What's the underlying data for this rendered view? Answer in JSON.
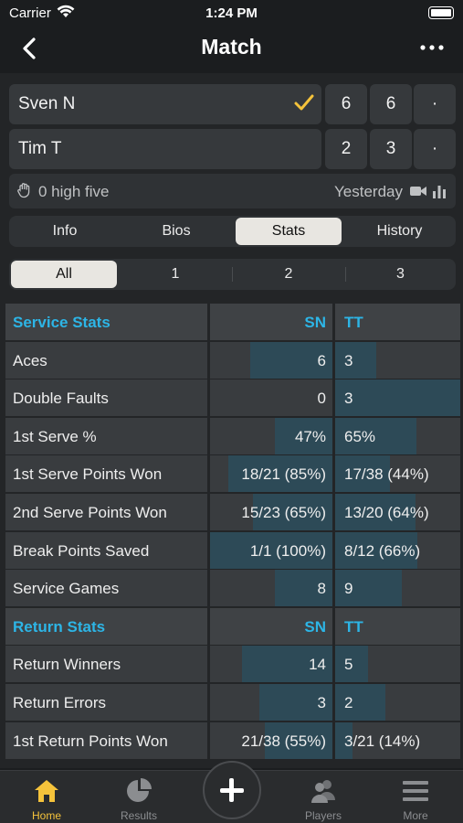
{
  "status": {
    "carrier": "Carrier",
    "time": "1:24 PM"
  },
  "nav": {
    "title": "Match"
  },
  "players": [
    {
      "name": "Sven N",
      "sets": [
        "6",
        "6",
        "·"
      ]
    },
    {
      "name": "Tim T",
      "sets": [
        "2",
        "3",
        "·"
      ]
    }
  ],
  "info": {
    "high_five": "0 high five",
    "date": "Yesterday"
  },
  "tabs": [
    {
      "label": "Info",
      "active": false
    },
    {
      "label": "Bios",
      "active": false
    },
    {
      "label": "Stats",
      "active": true
    },
    {
      "label": "History",
      "active": false
    }
  ],
  "set_filter": [
    {
      "label": "All",
      "active": true
    },
    {
      "label": "1",
      "active": false
    },
    {
      "label": "2",
      "active": false
    },
    {
      "label": "3",
      "active": false
    }
  ],
  "stats": [
    {
      "type": "header",
      "label": "Service Stats",
      "sn": "SN",
      "tt": "TT"
    },
    {
      "label": "Aces",
      "sn": "6",
      "tt": "3",
      "sn_share": 0.67,
      "tt_share": 0.33
    },
    {
      "label": "Double Faults",
      "sn": "0",
      "tt": "3",
      "sn_share": 0.0,
      "tt_share": 1.0
    },
    {
      "label": "1st Serve %",
      "sn": "47%",
      "tt": "65%",
      "sn_share": 0.47,
      "tt_share": 0.65
    },
    {
      "label": "1st Serve Points Won",
      "sn": "18/21 (85%)",
      "tt": "17/38 (44%)",
      "sn_share": 0.85,
      "tt_share": 0.44
    },
    {
      "label": "2nd Serve Points Won",
      "sn": "15/23 (65%)",
      "tt": "13/20 (64%)",
      "sn_share": 0.65,
      "tt_share": 0.64
    },
    {
      "label": "Break Points Saved",
      "sn": "1/1 (100%)",
      "tt": "8/12 (66%)",
      "sn_share": 1.0,
      "tt_share": 0.66
    },
    {
      "label": "Service Games",
      "sn": "8",
      "tt": "9",
      "sn_share": 0.47,
      "tt_share": 0.53
    },
    {
      "type": "header",
      "label": "Return Stats",
      "sn": "SN",
      "tt": "TT"
    },
    {
      "label": "Return Winners",
      "sn": "14",
      "tt": "5",
      "sn_share": 0.74,
      "tt_share": 0.26
    },
    {
      "label": "Return Errors",
      "sn": "3",
      "tt": "2",
      "sn_share": 0.6,
      "tt_share": 0.4
    },
    {
      "label": "1st Return Points Won",
      "sn": "21/38 (55%)",
      "tt": "3/21 (14%)",
      "sn_share": 0.55,
      "tt_share": 0.14
    }
  ],
  "tab_bar": [
    {
      "label": "Home",
      "icon": "home-icon",
      "active": true
    },
    {
      "label": "Results",
      "icon": "pie-chart-icon",
      "active": false
    },
    {
      "label": "Players",
      "icon": "players-icon",
      "active": false
    },
    {
      "label": "More",
      "icon": "menu-icon",
      "active": false
    }
  ],
  "colors": {
    "accent": "#2db5e6",
    "active_tab": "#f5c33b",
    "bar_fill": "#2d4a57",
    "check": "#f5c33b"
  }
}
